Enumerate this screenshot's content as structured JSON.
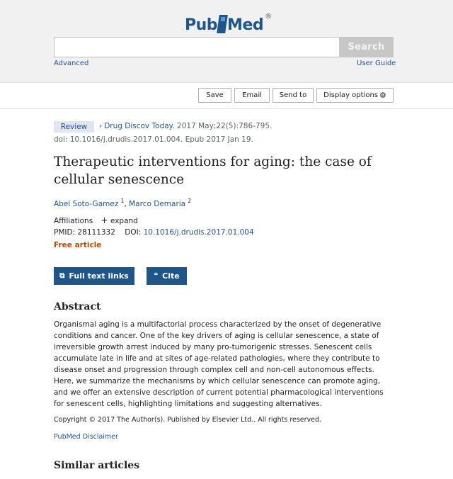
{
  "header": {
    "logo_pub": "Pub",
    "logo_med": "Med",
    "logo_reg": "®",
    "search": {
      "value": "",
      "placeholder": ""
    },
    "search_button": "Search",
    "advanced_link": "Advanced",
    "user_guide_link": "User Guide"
  },
  "toolbar": {
    "save": "Save",
    "email": "Email",
    "send_to": "Send to",
    "display_options": "Display options"
  },
  "article": {
    "type_badge": "Review",
    "journal": "Drug Discov Today.",
    "citation": "2017 May;22(5):786-795.",
    "doi_epub": "doi: 10.1016/j.drudis.2017.01.004. Epub 2017 Jan 19.",
    "title": "Therapeutic interventions for aging: the case of cellular senescence",
    "authors": [
      {
        "name": "Abel Soto-Gamez",
        "sup": "1"
      },
      {
        "name": "Marco Demaria",
        "sup": "2"
      }
    ],
    "affiliations_label": "Affiliations",
    "expand_label": "expand",
    "pmid_label": "PMID:",
    "pmid": "28111332",
    "doi_label": "DOI:",
    "doi": "10.1016/j.drudis.2017.01.004",
    "free_label": "Free article"
  },
  "buttons": {
    "full_text": "Full text links",
    "cite": "Cite"
  },
  "abstract": {
    "heading": "Abstract",
    "text": "Organismal aging is a multifactorial process characterized by the onset of degenerative conditions and cancer. One of the key drivers of aging is cellular senescence, a state of irreversible growth arrest induced by many pro-tumorigenic stresses. Senescent cells accumulate late in life and at sites of age-related pathologies, where they contribute to disease onset and progression through complex cell and non-cell autonomous effects. Here, we summarize the mechanisms by which cellular senescence can promote aging, and we offer an extensive description of current potential pharmacological interventions for senescent cells, highlighting limitations and suggesting alternatives.",
    "copyright": "Copyright © 2017 The Author(s). Published by Elsevier Ltd.. All rights reserved.",
    "disclaimer": "PubMed Disclaimer"
  },
  "similar_heading": "Similar articles",
  "colors": {
    "brand": "#20558a",
    "link": "#205493",
    "free": "#b34710"
  }
}
